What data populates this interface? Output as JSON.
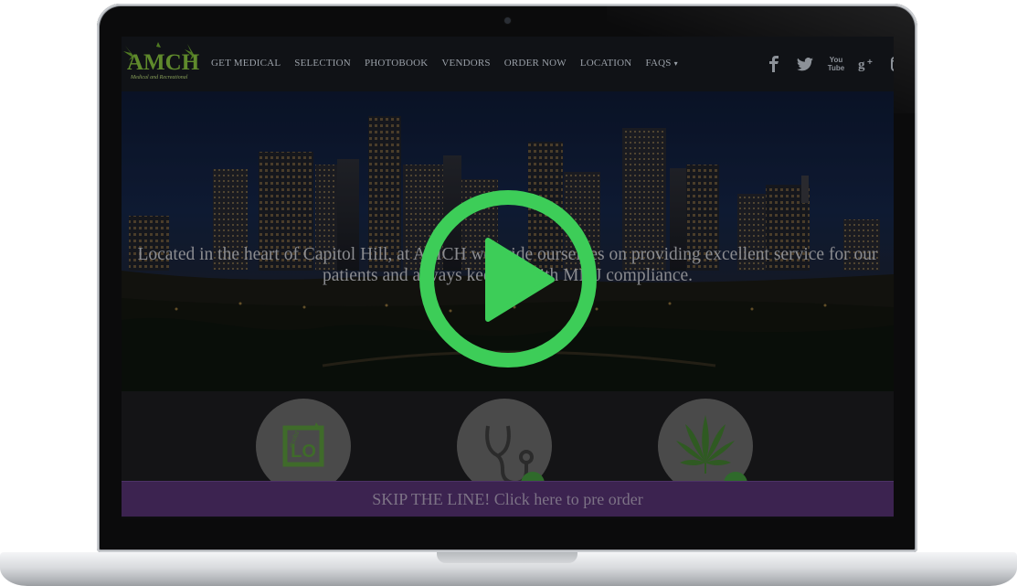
{
  "site": {
    "logo_text": "AMCH",
    "logo_tagline": "Medical and Recreational"
  },
  "nav": {
    "items": [
      {
        "label": "GET MEDICAL"
      },
      {
        "label": "SELECTION"
      },
      {
        "label": "PHOTOBOOK"
      },
      {
        "label": "VENDORS"
      },
      {
        "label": "ORDER NOW"
      },
      {
        "label": "LOCATION"
      },
      {
        "label": "FAQS",
        "dropdown": true
      }
    ],
    "caret": "▾"
  },
  "social": [
    {
      "icon": "facebook-icon",
      "glyph": "f"
    },
    {
      "icon": "twitter-icon",
      "glyph": "🐦"
    },
    {
      "icon": "youtube-icon",
      "glyph": "You Tube"
    },
    {
      "icon": "google-plus-icon",
      "glyph": "g+"
    },
    {
      "icon": "instagram-icon",
      "glyph": "◘"
    }
  ],
  "hero": {
    "text": "Located in the heart of Capitol Hill, at AMCH we pride ourselves on providing excellent service for our patients and always keep up with MMJ compliance."
  },
  "features": [
    {
      "icon": "doobz-logo-icon",
      "label": "LO"
    },
    {
      "icon": "stethoscope-icon"
    },
    {
      "icon": "cannabis-leaf-icon"
    }
  ],
  "cta": {
    "label": "SKIP THE LINE! Click here to pre order"
  },
  "video": {
    "play_icon": "play-icon"
  },
  "colors": {
    "play_green": "#3dcd58",
    "cta_purple": "#3c2350",
    "logo_green": "#5f8a2c"
  }
}
